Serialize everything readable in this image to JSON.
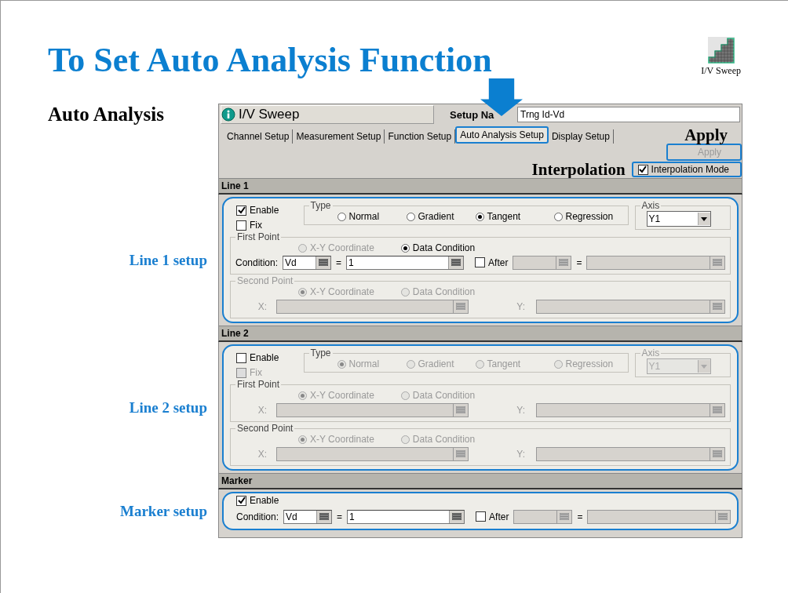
{
  "slide": {
    "title": "To Set Auto Analysis Function",
    "subtitle": "Auto Analysis",
    "icon_label": "I/V Sweep"
  },
  "window": {
    "title": "I/V Sweep",
    "setup_name": {
      "label": "Setup Na",
      "value": "Trng Id-Vd"
    },
    "tabs": [
      {
        "label": "Channel Setup",
        "selected": false
      },
      {
        "label": "Measurement Setup",
        "selected": false
      },
      {
        "label": "Function Setup",
        "selected": false
      },
      {
        "label": "Auto Analysis Setup",
        "selected": true
      },
      {
        "label": "Display Setup",
        "selected": false
      }
    ],
    "apply": {
      "annotation": "Apply",
      "label": "Apply",
      "disabled": true
    },
    "interpolation": {
      "annotation": "Interpolation",
      "label": "Interpolation Mode",
      "checked": true
    }
  },
  "sections": [
    {
      "kind": "line",
      "heading": "Line 1",
      "callout": "Line 1 setup",
      "enable": {
        "label": "Enable",
        "checked": true
      },
      "fix": {
        "label": "Fix",
        "checked": false,
        "disabled": false
      },
      "type": {
        "label": "Type",
        "options": [
          {
            "label": "Normal",
            "selected": false,
            "disabled": false
          },
          {
            "label": "Gradient",
            "selected": false,
            "disabled": false
          },
          {
            "label": "Tangent",
            "selected": true,
            "disabled": false
          },
          {
            "label": "Regression",
            "selected": false,
            "disabled": false
          }
        ]
      },
      "axis": {
        "label": "Axis",
        "value": "Y1",
        "disabled": false
      },
      "points": [
        {
          "label": "First Point",
          "disabled": false,
          "options": [
            {
              "label": "X-Y Coordinate",
              "selected": false,
              "disabled": true
            },
            {
              "label": "Data Condition",
              "selected": true,
              "disabled": false
            }
          ],
          "row": {
            "kind": "condition",
            "label": "Condition:",
            "name": "Vd",
            "equals": [
              "=",
              "="
            ],
            "value": "1",
            "after": {
              "label": "After",
              "checked": false
            }
          }
        },
        {
          "label": "Second Point",
          "disabled": true,
          "options": [
            {
              "label": "X-Y Coordinate",
              "selected": true,
              "disabled": true
            },
            {
              "label": "Data Condition",
              "selected": false,
              "disabled": true
            }
          ],
          "row": {
            "kind": "xy",
            "x_label": "X:",
            "y_label": "Y:",
            "disabled": true
          }
        }
      ]
    },
    {
      "kind": "line",
      "heading": "Line 2",
      "callout": "Line 2 setup",
      "enable": {
        "label": "Enable",
        "checked": false
      },
      "fix": {
        "label": "Fix",
        "checked": false,
        "disabled": true
      },
      "type": {
        "label": "Type",
        "options": [
          {
            "label": "Normal",
            "selected": true,
            "disabled": true
          },
          {
            "label": "Gradient",
            "selected": false,
            "disabled": true
          },
          {
            "label": "Tangent",
            "selected": false,
            "disabled": true
          },
          {
            "label": "Regression",
            "selected": false,
            "disabled": true
          }
        ]
      },
      "axis": {
        "label": "Axis",
        "value": "Y1",
        "disabled": true
      },
      "points": [
        {
          "label": "First Point",
          "disabled": false,
          "options": [
            {
              "label": "X-Y Coordinate",
              "selected": true,
              "disabled": true
            },
            {
              "label": "Data Condition",
              "selected": false,
              "disabled": true
            }
          ],
          "row": {
            "kind": "xy",
            "x_label": "X:",
            "y_label": "Y:",
            "disabled": true
          }
        },
        {
          "label": "Second Point",
          "disabled": false,
          "options": [
            {
              "label": "X-Y Coordinate",
              "selected": true,
              "disabled": true
            },
            {
              "label": "Data Condition",
              "selected": false,
              "disabled": true
            }
          ],
          "row": {
            "kind": "xy",
            "x_label": "X:",
            "y_label": "Y:",
            "disabled": true
          }
        }
      ]
    },
    {
      "kind": "marker",
      "heading": "Marker",
      "callout": "Marker setup",
      "enable": {
        "label": "Enable",
        "checked": true
      },
      "row": {
        "kind": "condition",
        "label": "Condition:",
        "name": "Vd",
        "equals": [
          "=",
          "="
        ],
        "value": "1",
        "after": {
          "label": "After",
          "checked": false
        }
      }
    }
  ]
}
